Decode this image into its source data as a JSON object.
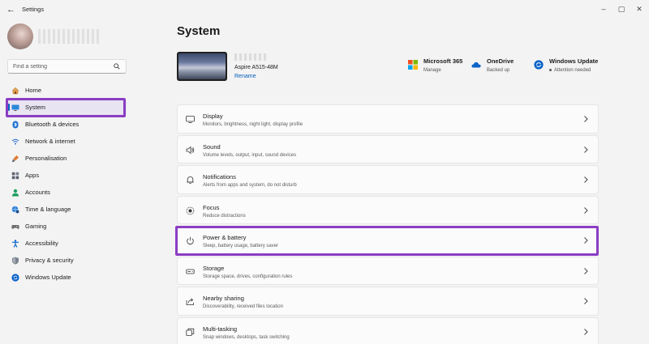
{
  "window": {
    "title": "Settings",
    "back_label": "←",
    "minimize": "–",
    "maximize": "▢",
    "close": "✕"
  },
  "search": {
    "placeholder": "Find a setting"
  },
  "sidebar": {
    "items": [
      {
        "label": "Home",
        "icon": "home-icon",
        "color": "#d98b3a"
      },
      {
        "label": "System",
        "icon": "display-icon",
        "color": "#0078d4"
      },
      {
        "label": "Bluetooth & devices",
        "icon": "bluetooth-icon",
        "color": "#0078d4"
      },
      {
        "label": "Network & internet",
        "icon": "wifi-icon",
        "color": "#0078d4"
      },
      {
        "label": "Personalisation",
        "icon": "brush-icon",
        "color": "#d96b2b"
      },
      {
        "label": "Apps",
        "icon": "apps-icon",
        "color": "#5b5b6e"
      },
      {
        "label": "Accounts",
        "icon": "person-icon",
        "color": "#1a9e5c"
      },
      {
        "label": "Time & language",
        "icon": "globe-clock-icon",
        "color": "#0078d4"
      },
      {
        "label": "Gaming",
        "icon": "gamepad-icon",
        "color": "#6e6e6e"
      },
      {
        "label": "Accessibility",
        "icon": "accessibility-icon",
        "color": "#0a63c9"
      },
      {
        "label": "Privacy & security",
        "icon": "shield-icon",
        "color": "#6e7680"
      },
      {
        "label": "Windows Update",
        "icon": "update-icon",
        "color": "#0a63c9"
      }
    ]
  },
  "main": {
    "title": "System",
    "device": {
      "model": "Aspire A515-48M",
      "rename": "Rename"
    },
    "quick_links": [
      {
        "title": "Microsoft 365",
        "subtitle": "Manage"
      },
      {
        "title": "OneDrive",
        "subtitle": "Backed up"
      },
      {
        "title": "Windows Update",
        "subtitle": "Attention needed"
      }
    ],
    "cards": [
      {
        "title": "Display",
        "subtitle": "Monitors, brightness, night light, display profile",
        "icon": "monitor-icon"
      },
      {
        "title": "Sound",
        "subtitle": "Volume levels, output, input, sound devices",
        "icon": "speaker-icon"
      },
      {
        "title": "Notifications",
        "subtitle": "Alerts from apps and system, do not disturb",
        "icon": "bell-icon"
      },
      {
        "title": "Focus",
        "subtitle": "Reduce distractions",
        "icon": "focus-icon"
      },
      {
        "title": "Power & battery",
        "subtitle": "Sleep, battery usage, battery saver",
        "icon": "power-icon"
      },
      {
        "title": "Storage",
        "subtitle": "Storage space, drives, configuration rules",
        "icon": "storage-icon"
      },
      {
        "title": "Nearby sharing",
        "subtitle": "Discoverability, received files location",
        "icon": "share-icon"
      },
      {
        "title": "Multi-tasking",
        "subtitle": "Snap windows, desktops, task switching",
        "icon": "multitask-icon"
      }
    ]
  },
  "colors": {
    "accent": "#0067c0",
    "highlight": "#8b3dc4",
    "link": "#005fb8"
  }
}
